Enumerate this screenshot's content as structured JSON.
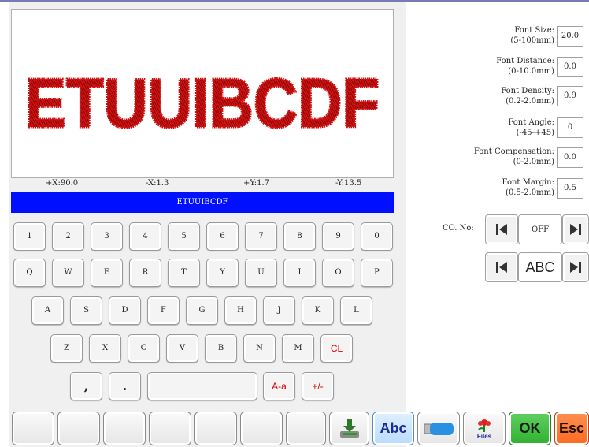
{
  "preview": {
    "text": "ETUUIBCDF",
    "color": "#cc1111"
  },
  "coords": {
    "x_plus": "+X:90.0",
    "x_minus": "-X:1.3",
    "y_plus": "+Y:1.7",
    "y_minus": "-Y:13.5"
  },
  "textbar": {
    "value": "ETUUIBCDF",
    "color": "#0010ff"
  },
  "keyboard": {
    "row1": [
      "1",
      "2",
      "3",
      "4",
      "5",
      "6",
      "7",
      "8",
      "9",
      "0"
    ],
    "row2": [
      "Q",
      "W",
      "E",
      "R",
      "T",
      "Y",
      "U",
      "I",
      "O",
      "P"
    ],
    "row3": [
      "A",
      "S",
      "D",
      "F",
      "G",
      "H",
      "J",
      "K",
      "L"
    ],
    "row4": [
      "Z",
      "X",
      "C",
      "V",
      "B",
      "N",
      "M"
    ],
    "clear": "CL",
    "comma": ",",
    "dot": ".",
    "case": "A-a",
    "sign": "+/-"
  },
  "params": [
    {
      "label": "Font Size:",
      "range": "(5-100mm)",
      "value": "20.0"
    },
    {
      "label": "Font Distance:",
      "range": "(0-10.0mm)",
      "value": "0.0"
    },
    {
      "label": "Font Density:",
      "range": "(0.2-2.0mm)",
      "value": "0.9"
    },
    {
      "label": "Font Angle:",
      "range": "(-45-+45)",
      "value": "0"
    },
    {
      "label": "Font Compensation:",
      "range": "(0-2.0mm)",
      "value": "0.0"
    },
    {
      "label": "Font Margin:",
      "range": "(0.5-2.0mm)",
      "value": "0.5"
    }
  ],
  "co_no": {
    "label": "CO. No:",
    "value": "OFF"
  },
  "font_select": {
    "value": "ABC"
  },
  "bottom": {
    "abc": "Abc",
    "files": "Files",
    "ok": "OK",
    "esc": "Esc"
  },
  "colors": {
    "ok": "#30b030",
    "esc": "#ff6a20",
    "abc_text": "#1a2a9a"
  }
}
